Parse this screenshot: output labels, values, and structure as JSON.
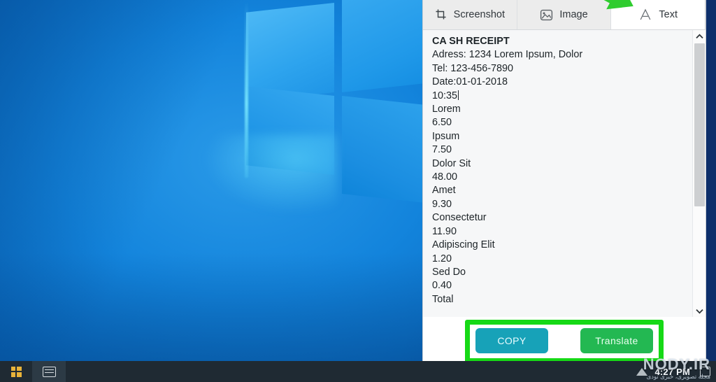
{
  "desktop": {
    "wallpaper_name": "windows-10-hero-wallpaper",
    "accent_blue": "#1384dc"
  },
  "taskbar": {
    "start_button_label": "Start",
    "task_view_icon": "task-view-icon",
    "clock": "4:27 PM",
    "tray": {
      "network_icon": "wifi-icon",
      "action_center_icon": "notification-icon"
    }
  },
  "panel": {
    "tabs": [
      {
        "label": "Screenshot",
        "icon": "crop-icon",
        "active": false
      },
      {
        "label": "Image",
        "icon": "picture-icon",
        "active": false
      },
      {
        "label": "Text",
        "icon": "letter-a-icon",
        "active": true
      }
    ],
    "text_content": {
      "lines": [
        "CA SH RECEIPT",
        "Adress: 1234 Lorem Ipsum, Dolor",
        "Tel: 123-456-7890",
        "Date:01-01-2018",
        "10:35",
        "Lorem",
        "6.50",
        "Ipsum",
        "7.50",
        "Dolor Sit",
        "48.00",
        "Amet",
        "9.30",
        "Consectetur",
        "11.90",
        "Adipiscing Elit",
        "1.20",
        "Sed Do",
        "0.40",
        "Total"
      ],
      "caret_after_line_index": 4
    },
    "scrollbar": {
      "up_arrow": "⌃",
      "down_arrow": "⌄",
      "thumb_size_percent": 62
    },
    "footer": {
      "copy_label": "COPY",
      "copy_color": "#17a2b8",
      "translate_label": "Translate",
      "translate_color": "#23b852"
    }
  },
  "annotations": {
    "highlight_color": "#16d916",
    "arrow_color": "#2fcc2f",
    "arrow_target": "text-tab"
  },
  "watermark": {
    "site": "NODY.IR",
    "subtitle": "مجله تصویری، خبری نودی"
  }
}
